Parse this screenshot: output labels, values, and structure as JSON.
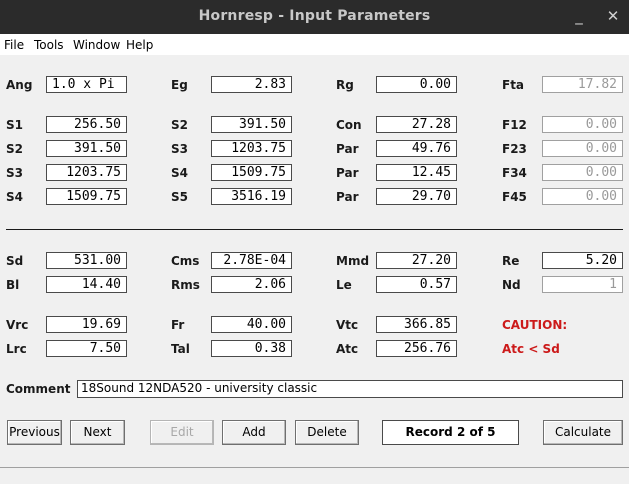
{
  "window": {
    "title": "Hornresp - Input Parameters",
    "minimize": "_",
    "close": "✕"
  },
  "menu": {
    "file": "File",
    "tools": "Tools",
    "window": "Window",
    "help": "Help"
  },
  "params": {
    "ang": {
      "label": "Ang",
      "value": "1.0 x Pi"
    },
    "eg": {
      "label": "Eg",
      "value": "2.83"
    },
    "rg": {
      "label": "Rg",
      "value": "0.00"
    },
    "fta": {
      "label": "Fta",
      "value": "17.82"
    },
    "s1a": {
      "label": "S1",
      "value": "256.50"
    },
    "s2a": {
      "label": "S2",
      "value": "391.50"
    },
    "con": {
      "label": "Con",
      "value": "27.28"
    },
    "f12": {
      "label": "F12",
      "value": "0.00"
    },
    "s2b": {
      "label": "S2",
      "value": "391.50"
    },
    "s3a": {
      "label": "S3",
      "value": "1203.75"
    },
    "par1": {
      "label": "Par",
      "value": "49.76"
    },
    "f23": {
      "label": "F23",
      "value": "0.00"
    },
    "s3b": {
      "label": "S3",
      "value": "1203.75"
    },
    "s4a": {
      "label": "S4",
      "value": "1509.75"
    },
    "par2": {
      "label": "Par",
      "value": "12.45"
    },
    "f34": {
      "label": "F34",
      "value": "0.00"
    },
    "s4b": {
      "label": "S4",
      "value": "1509.75"
    },
    "s5": {
      "label": "S5",
      "value": "3516.19"
    },
    "par3": {
      "label": "Par",
      "value": "29.70"
    },
    "f45": {
      "label": "F45",
      "value": "0.00"
    },
    "sd": {
      "label": "Sd",
      "value": "531.00"
    },
    "cms": {
      "label": "Cms",
      "value": "2.78E-04"
    },
    "mmd": {
      "label": "Mmd",
      "value": "27.20"
    },
    "re": {
      "label": "Re",
      "value": "5.20"
    },
    "bl": {
      "label": "Bl",
      "value": "14.40"
    },
    "rms": {
      "label": "Rms",
      "value": "2.06"
    },
    "le": {
      "label": "Le",
      "value": "0.57"
    },
    "nd": {
      "label": "Nd",
      "value": "1"
    },
    "vrc": {
      "label": "Vrc",
      "value": "19.69"
    },
    "fr": {
      "label": "Fr",
      "value": "40.00"
    },
    "vtc": {
      "label": "Vtc",
      "value": "366.85"
    },
    "lrc": {
      "label": "Lrc",
      "value": "7.50"
    },
    "tal": {
      "label": "Tal",
      "value": "0.38"
    },
    "atc": {
      "label": "Atc",
      "value": "256.76"
    }
  },
  "warning": {
    "title": "CAUTION:",
    "message": "Atc < Sd"
  },
  "comment": {
    "label": "Comment",
    "value": "18Sound 12NDA520 - university classic"
  },
  "buttons": {
    "previous": "Previous",
    "next": "Next",
    "edit": "Edit",
    "add": "Add",
    "delete": "Delete",
    "calculate": "Calculate"
  },
  "record": "Record 2 of 5",
  "colors": {
    "titlebar": "#2b2b2b",
    "caution": "#cc1a1a",
    "background": "#f0f0f0"
  }
}
